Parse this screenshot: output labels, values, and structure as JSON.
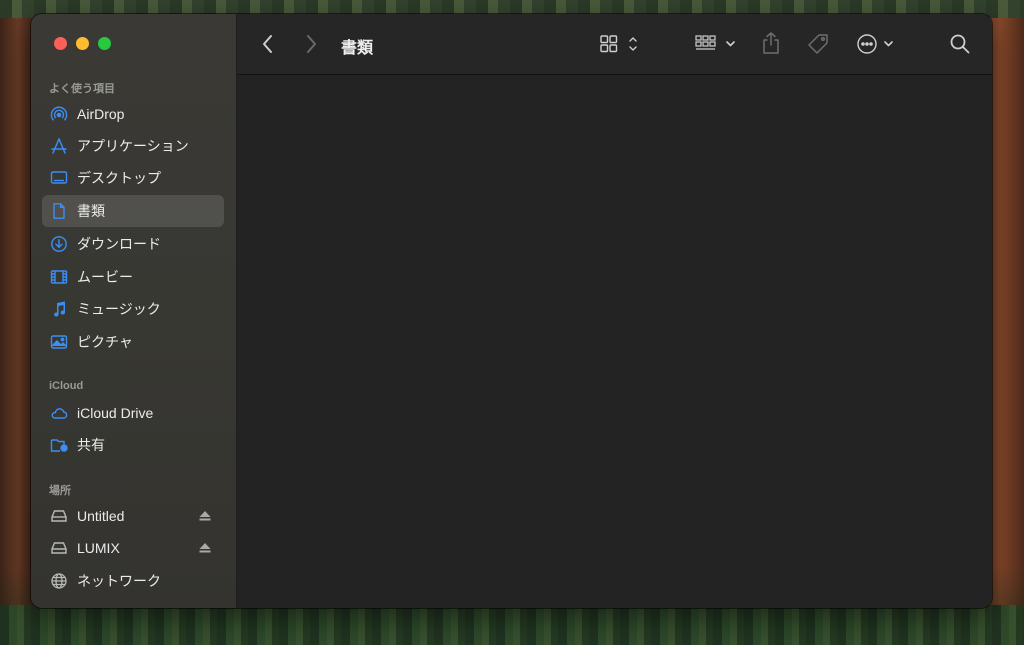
{
  "window": {
    "title": "書類"
  },
  "sidebar": {
    "favorites_title": "よく使う項目",
    "favorites": [
      {
        "label": "AirDrop",
        "icon": "airdrop-icon"
      },
      {
        "label": "アプリケーション",
        "icon": "applications-icon"
      },
      {
        "label": "デスクトップ",
        "icon": "desktop-icon"
      },
      {
        "label": "書類",
        "icon": "document-icon",
        "selected": true
      },
      {
        "label": "ダウンロード",
        "icon": "download-icon"
      },
      {
        "label": "ムービー",
        "icon": "movies-icon"
      },
      {
        "label": "ミュージック",
        "icon": "music-icon"
      },
      {
        "label": "ピクチャ",
        "icon": "pictures-icon"
      }
    ],
    "icloud_title": "iCloud",
    "icloud": [
      {
        "label": "iCloud Drive",
        "icon": "icloud-icon"
      },
      {
        "label": "共有",
        "icon": "shared-folder-icon"
      }
    ],
    "locations_title": "場所",
    "locations": [
      {
        "label": "Untitled",
        "icon": "drive-icon",
        "ejectable": true
      },
      {
        "label": "LUMIX",
        "icon": "drive-icon",
        "ejectable": true
      },
      {
        "label": "ネットワーク",
        "icon": "network-icon"
      }
    ]
  },
  "colors": {
    "accent": "#3b8ef5",
    "sidebar_bg": "#383833",
    "content_bg": "#232323",
    "toolbar_bg": "#262626"
  }
}
